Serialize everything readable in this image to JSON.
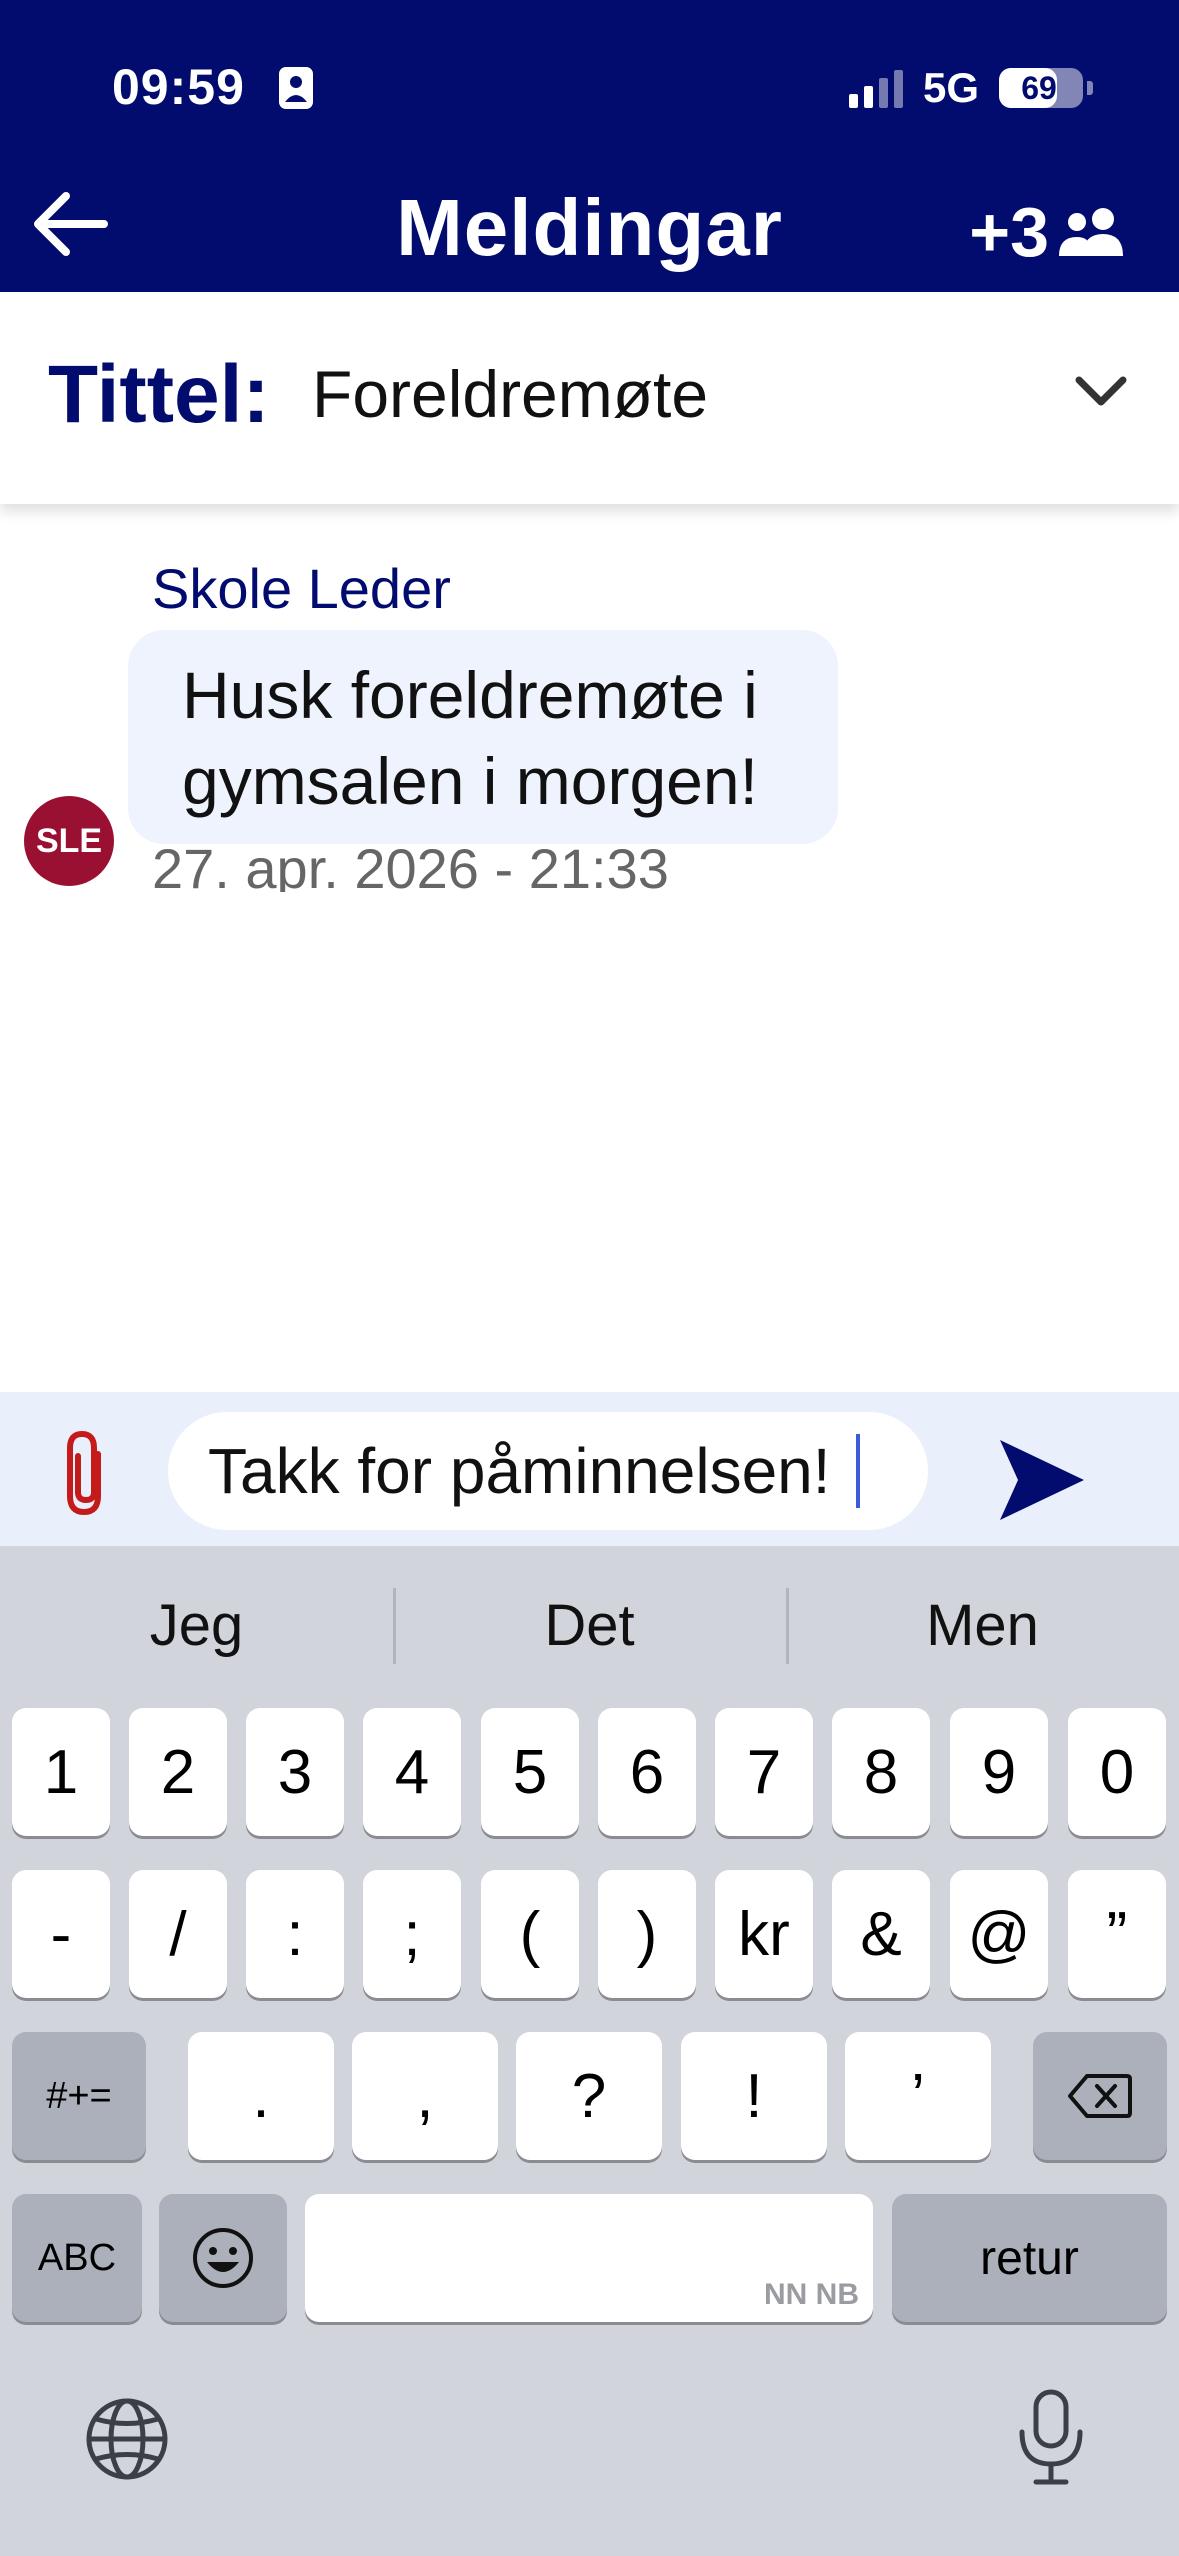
{
  "status_bar": {
    "time": "09:59",
    "network": "5G",
    "battery": "69",
    "battery_level": 0.69
  },
  "header": {
    "title": "Meldingar",
    "participants_count": "+3"
  },
  "conversation": {
    "title_label": "Tittel:",
    "title_value": "Foreldremøte"
  },
  "messages": [
    {
      "sender": "Skole Leder",
      "avatar_initials": "SLE",
      "text": "Husk foreldremøte i gymsalen i morgen!",
      "timestamp": "27. apr. 2026 - 21:33"
    }
  ],
  "composer": {
    "value": "Takk for påminnelsen!"
  },
  "keyboard": {
    "suggestions": [
      "Jeg",
      "Det",
      "Men"
    ],
    "row1": [
      "1",
      "2",
      "3",
      "4",
      "5",
      "6",
      "7",
      "8",
      "9",
      "0"
    ],
    "row2": [
      "-",
      "/",
      ":",
      ";",
      "(",
      ")",
      "kr",
      "&",
      "@",
      "”"
    ],
    "row3": [
      "#+=",
      ".",
      ",",
      "?",
      "!",
      "’"
    ],
    "abc": "ABC",
    "space_hint": "NN NB",
    "return": "retur"
  },
  "colors": {
    "header_bg": "#020c6e",
    "avatar_bg": "#9a1032",
    "bubble_bg": "#eef3fd",
    "composer_bg": "#eaf0fb",
    "attach": "#c41a1a",
    "send": "#020c6e"
  },
  "icons": [
    "person-card-icon",
    "back-arrow-icon",
    "group-icon",
    "chevron-down-icon",
    "paperclip-icon",
    "send-icon",
    "backspace-icon",
    "emoji-icon",
    "globe-icon",
    "microphone-icon"
  ]
}
